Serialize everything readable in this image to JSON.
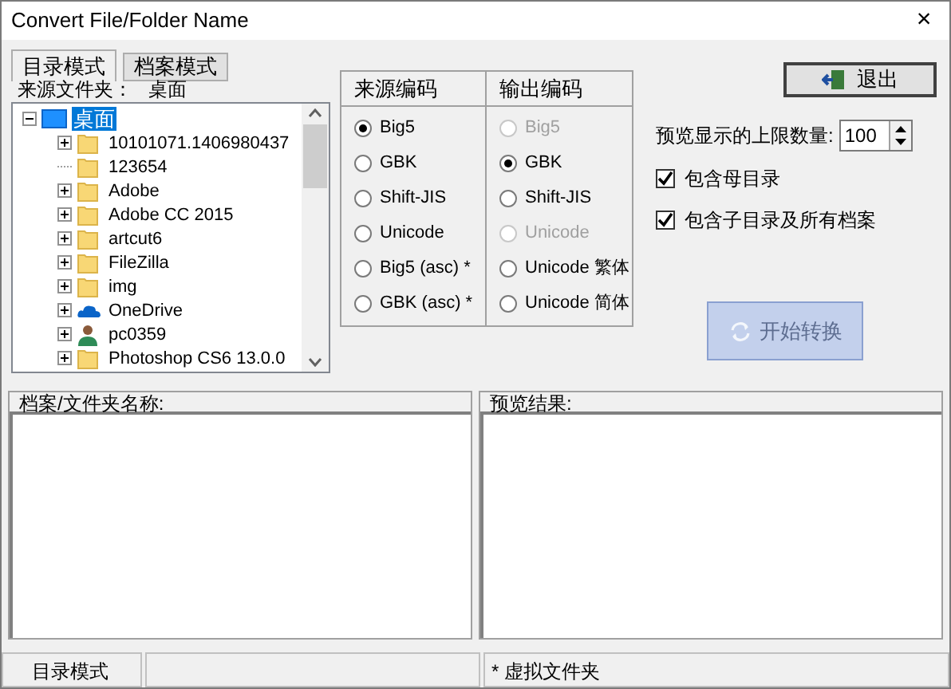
{
  "window": {
    "title": "Convert File/Folder Name",
    "close": "×"
  },
  "tabs": [
    {
      "label": "目录模式",
      "selected": true
    },
    {
      "label": "档案模式",
      "selected": false
    }
  ],
  "exit_button": {
    "label": "退出"
  },
  "source_folder": {
    "label": "来源文件夹：",
    "value": "桌面"
  },
  "tree": {
    "label": "桌面",
    "kind": "desktop",
    "expanded": true,
    "selected": true,
    "children": [
      {
        "label": "10101071.1406980437",
        "kind": "folder",
        "expandable": true,
        "expanded": false,
        "selected": false
      },
      {
        "label": "123654",
        "kind": "folder",
        "expandable": false,
        "selected": false
      },
      {
        "label": "Adobe",
        "kind": "folder",
        "expandable": true,
        "expanded": false,
        "selected": false
      },
      {
        "label": "Adobe CC 2015",
        "kind": "folder",
        "expandable": true,
        "expanded": false,
        "selected": false
      },
      {
        "label": "artcut6",
        "kind": "folder",
        "expandable": true,
        "expanded": false,
        "selected": false
      },
      {
        "label": "FileZilla",
        "kind": "folder",
        "expandable": true,
        "expanded": false,
        "selected": false
      },
      {
        "label": "img",
        "kind": "folder",
        "expandable": true,
        "expanded": false,
        "selected": false
      },
      {
        "label": "OneDrive",
        "kind": "cloud",
        "expandable": true,
        "expanded": false,
        "selected": false
      },
      {
        "label": "pc0359",
        "kind": "user",
        "expandable": true,
        "expanded": false,
        "selected": false
      },
      {
        "label": "Photoshop CS6 13.0.0",
        "kind": "folder",
        "expandable": true,
        "expanded": false,
        "selected": false
      }
    ]
  },
  "source_encoding": {
    "heading": "来源编码",
    "options": [
      {
        "label": "Big5",
        "selected": true,
        "disabled": false
      },
      {
        "label": "GBK",
        "selected": false,
        "disabled": false
      },
      {
        "label": "Shift-JIS",
        "selected": false,
        "disabled": false
      },
      {
        "label": "Unicode",
        "selected": false,
        "disabled": false
      },
      {
        "label": "Big5 (asc) *",
        "selected": false,
        "disabled": false
      },
      {
        "label": "GBK (asc) *",
        "selected": false,
        "disabled": false
      }
    ]
  },
  "output_encoding": {
    "heading": "输出编码",
    "options": [
      {
        "label": "Big5",
        "selected": false,
        "disabled": true
      },
      {
        "label": "GBK",
        "selected": true,
        "disabled": false
      },
      {
        "label": "Shift-JIS",
        "selected": false,
        "disabled": false
      },
      {
        "label": "Unicode",
        "selected": false,
        "disabled": true
      },
      {
        "label": "Unicode 繁体",
        "selected": false,
        "disabled": false
      },
      {
        "label": "Unicode 简体",
        "selected": false,
        "disabled": false
      }
    ]
  },
  "preview_limit": {
    "label": "预览显示的上限数量:",
    "value": "100"
  },
  "checkboxes": [
    {
      "label": "包含母目录",
      "checked": true
    },
    {
      "label": "包含子目录及所有档案",
      "checked": true
    }
  ],
  "start_button": {
    "label": "开始转换",
    "disabled": true
  },
  "panes": [
    {
      "heading": "档案/文件夹名称:"
    },
    {
      "heading": "预览结果:"
    }
  ],
  "status_bar": {
    "mode": "目录模式",
    "note": "* 虚拟文件夹"
  }
}
